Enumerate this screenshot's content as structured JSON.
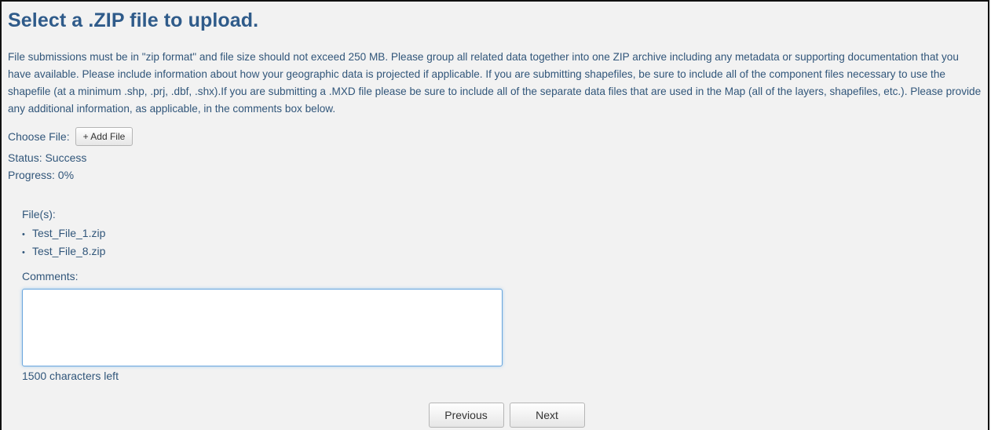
{
  "page": {
    "title": "Select a .ZIP file to upload.",
    "description": "File submissions must be in \"zip format\" and file size should not exceed 250 MB. Please group all related data together into one ZIP archive including any metadata or supporting documentation that you have available. Please include information about how your geographic data is projected if applicable. If you are submitting shapefiles, be sure to include all of the component files necessary to use the shapefile (at a minimum .shp, .prj, .dbf, .shx).If you are submitting a .MXD file please be sure to include all of the separate data files that are used in the Map (all of the layers, shapefiles, etc.). Please provide any additional information, as applicable, in the comments box below."
  },
  "upload": {
    "choose_label": "Choose File:",
    "add_button": "+ Add File",
    "status": "Status: Success",
    "progress": "Progress: 0%"
  },
  "files": {
    "label": "File(s):",
    "items": [
      "Test_File_1.zip",
      "Test_File_8.zip"
    ]
  },
  "comments": {
    "label": "Comments:",
    "value": "",
    "chars_left": "1500 characters left"
  },
  "nav": {
    "previous": "Previous",
    "next": "Next"
  },
  "colors": {
    "text": "#31567a",
    "title": "#2f5b8a",
    "focus_border": "#6aa6dd"
  }
}
